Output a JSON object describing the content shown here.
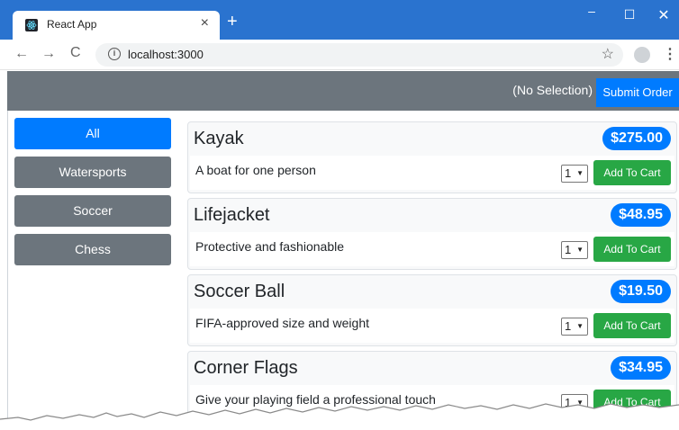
{
  "browser": {
    "tab_title": "React App",
    "tab_close": "×",
    "new_tab": "+",
    "url": "localhost:3000",
    "window_min": "–",
    "window_max": "☐",
    "window_close": "✕"
  },
  "header": {
    "selection": "(No Selection)",
    "submit_label": "Submit Order"
  },
  "categories": [
    {
      "label": "All",
      "active": true
    },
    {
      "label": "Watersports",
      "active": false
    },
    {
      "label": "Soccer",
      "active": false
    },
    {
      "label": "Chess",
      "active": false
    }
  ],
  "products": [
    {
      "name": "Kayak",
      "price": "$275.00",
      "description": "A boat for one person",
      "quantity": "1",
      "cart_label": "Add To Cart"
    },
    {
      "name": "Lifejacket",
      "price": "$48.95",
      "description": "Protective and fashionable",
      "quantity": "1",
      "cart_label": "Add To Cart"
    },
    {
      "name": "Soccer Ball",
      "price": "$19.50",
      "description": "FIFA-approved size and weight",
      "quantity": "1",
      "cart_label": "Add To Cart"
    },
    {
      "name": "Corner Flags",
      "price": "$34.95",
      "description": "Give your playing field a professional touch",
      "quantity": "1",
      "cart_label": "Add To Cart"
    }
  ],
  "colors": {
    "chrome": "#2a73cf",
    "navbar": "#6c757d",
    "primary": "#007bff",
    "success": "#28a745"
  }
}
